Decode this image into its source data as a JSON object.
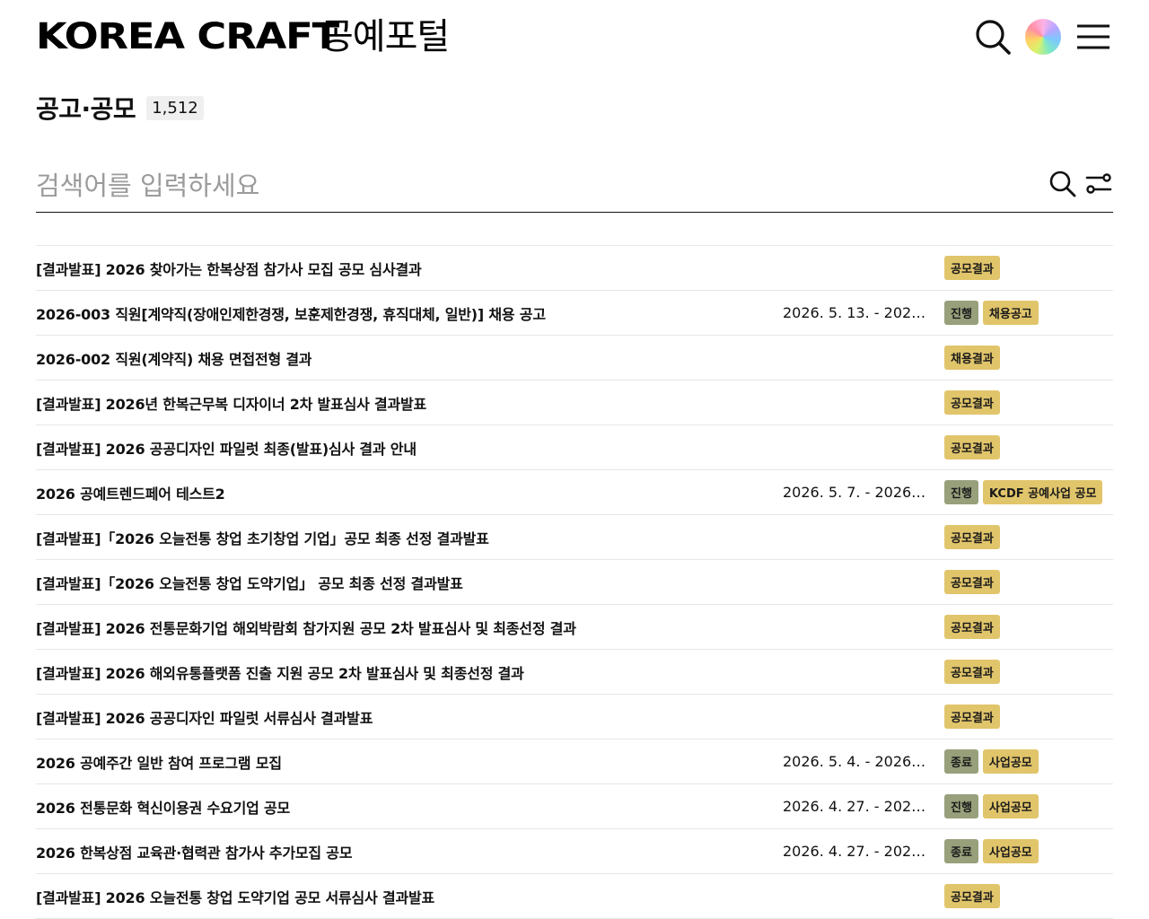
{
  "header": {
    "logo_en": "KOREA CRAFT",
    "logo_ko": "공예포털"
  },
  "page": {
    "title": "공고·공모",
    "count": "1,512"
  },
  "search": {
    "placeholder": "검색어를 입력하세요"
  },
  "colors": {
    "status_tag": "#97a07b",
    "category_tag": "#e1c56b",
    "divider": "#e6e6e6"
  },
  "rows": [
    {
      "title": "[결과발표] 2026 찾아가는 한복상점 참가사 모집 공모 심사결과",
      "date": "",
      "status": "",
      "category": "공모결과"
    },
    {
      "title": "2026-003 직원[계약직(장애인제한경쟁, 보훈제한경쟁, 휴직대체, 일반)] 채용 공고",
      "date": "2026. 5. 13. - 2026...",
      "status": "진행",
      "category": "채용공고"
    },
    {
      "title": "2026-002 직원(계약직) 채용 면접전형 결과",
      "date": "",
      "status": "",
      "category": "채용결과"
    },
    {
      "title": "[결과발표] 2026년 한복근무복 디자이너 2차 발표심사 결과발표",
      "date": "",
      "status": "",
      "category": "공모결과"
    },
    {
      "title": "[결과발표] 2026 공공디자인 파일럿 최종(발표)심사 결과 안내",
      "date": "",
      "status": "",
      "category": "공모결과"
    },
    {
      "title": "2026 공예트렌드페어 테스트2",
      "date": "2026. 5. 7. - 2026. ...",
      "status": "진행",
      "category": "KCDF 공예사업 공모"
    },
    {
      "title": "[결과발표]「2026 오늘전통 창업 초기창업 기업」공모 최종 선정 결과발표",
      "date": "",
      "status": "",
      "category": "공모결과"
    },
    {
      "title": "[결과발표]「2026 오늘전통 창업 도약기업」 공모 최종 선정 결과발표",
      "date": "",
      "status": "",
      "category": "공모결과"
    },
    {
      "title": "[결과발표] 2026 전통문화기업 해외박람회 참가지원 공모 2차 발표심사 및 최종선정 결과",
      "date": "",
      "status": "",
      "category": "공모결과"
    },
    {
      "title": "[결과발표] 2026 해외유통플랫폼 진출 지원 공모 2차 발표심사 및 최종선정 결과",
      "date": "",
      "status": "",
      "category": "공모결과"
    },
    {
      "title": "[결과발표] 2026 공공디자인 파일럿 서류심사 결과발표",
      "date": "",
      "status": "",
      "category": "공모결과"
    },
    {
      "title": "2026 공예주간 일반 참여 프로그램 모집",
      "date": "2026. 5. 4. - 2026. ...",
      "status": "종료",
      "category": "사업공모"
    },
    {
      "title": "2026 전통문화 혁신이용권 수요기업 공모",
      "date": "2026. 4. 27. - 2026...",
      "status": "진행",
      "category": "사업공모"
    },
    {
      "title": "2026 한복상점 교육관·협력관 참가사 추가모집 공모",
      "date": "2026. 4. 27. - 2026...",
      "status": "종료",
      "category": "사업공모"
    },
    {
      "title": "[결과발표] 2026 오늘전통 창업 도약기업 공모 서류심사 결과발표",
      "date": "",
      "status": "",
      "category": "공모결과"
    }
  ]
}
